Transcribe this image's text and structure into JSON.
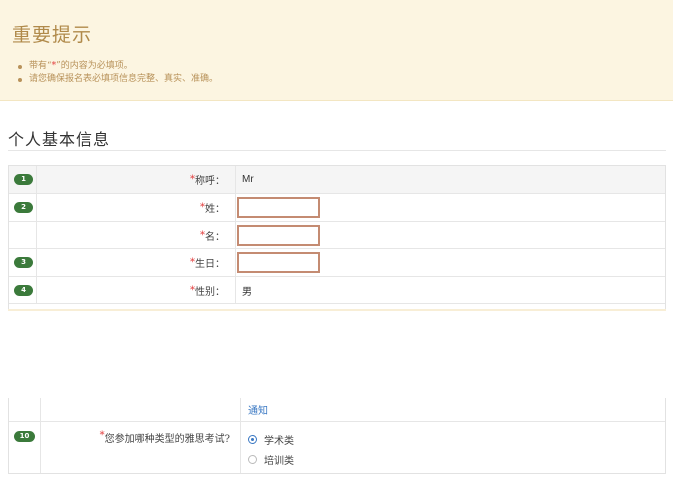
{
  "notice": {
    "title": "重要提示",
    "items": [
      {
        "prefix": "带有“",
        "star": "*",
        "suffix": "”的内容为必填项。"
      },
      {
        "text": "请您确保报名表必填项信息完整、真实、准确。"
      }
    ]
  },
  "section": {
    "title": "个人基本信息"
  },
  "form": {
    "rows": [
      {
        "num": "1",
        "label": "称呼：",
        "value": "Mr"
      },
      {
        "num": "2",
        "label": "姓：",
        "value": ""
      },
      {
        "label": "名：",
        "value": ""
      },
      {
        "num": "3",
        "label": "生日：",
        "value": ""
      },
      {
        "num": "4",
        "label": "性别：",
        "value": "男"
      }
    ],
    "required_mark": "*"
  },
  "lower": {
    "link_text": "通知",
    "question": {
      "num": "10",
      "label": "您参加哪种类型的雅思考试?",
      "options": [
        {
          "label": "学术类",
          "selected": true
        },
        {
          "label": "培训类",
          "selected": false
        }
      ]
    }
  }
}
